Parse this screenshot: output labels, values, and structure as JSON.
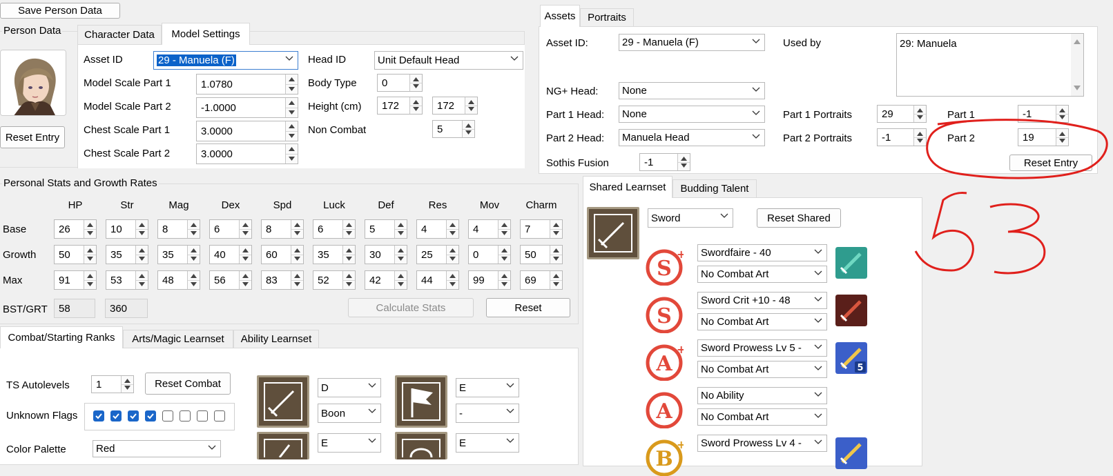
{
  "toolbar": {
    "save_person": "Save Person Data"
  },
  "person_data": {
    "group_label": "Person Data",
    "reset_entry": "Reset Entry",
    "tabs": [
      "Character Data",
      "Model Settings"
    ],
    "model": {
      "asset_id_label": "Asset ID",
      "asset_id_value": "29 - Manuela (F)",
      "head_id_label": "Head ID",
      "head_id_value": "Unit Default Head",
      "scale1_label": "Model Scale Part 1",
      "scale1_value": "1.0780",
      "scale2_label": "Model Scale Part 2",
      "scale2_value": "-1.0000",
      "chest1_label": "Chest Scale Part 1",
      "chest1_value": "3.0000",
      "chest2_label": "Chest Scale Part 2",
      "chest2_value": "3.0000",
      "body_type_label": "Body Type",
      "body_type_value": "0",
      "height_label": "Height (cm)",
      "height_value1": "172",
      "height_value2": "172",
      "non_combat_label": "Non Combat",
      "non_combat_value": "5"
    }
  },
  "assets": {
    "tabs": [
      "Assets",
      "Portraits"
    ],
    "asset_id_label": "Asset ID:",
    "asset_id_value": "29 - Manuela (F)",
    "used_by_label": "Used by",
    "used_by_value": "29: Manuela",
    "ng_head_label": "NG+ Head:",
    "ng_head_value": "None",
    "part1_head_label": "Part 1 Head:",
    "part1_head_value": "None",
    "part2_head_label": "Part 2 Head:",
    "part2_head_value": "Manuela Head",
    "part1_portraits_label": "Part 1 Portraits",
    "part1_portraits_value": "29",
    "part2_portraits_label": "Part 2 Portraits",
    "part2_portraits_value": "-1",
    "part1_label": "Part 1",
    "part1_value": "-1",
    "part2_label": "Part 2",
    "part2_value": "19",
    "sothis_label": "Sothis Fusion",
    "sothis_value": "-1",
    "reset_entry": "Reset Entry"
  },
  "stats": {
    "group_label": "Personal Stats and Growth Rates",
    "columns": [
      "HP",
      "Str",
      "Mag",
      "Dex",
      "Spd",
      "Luck",
      "Def",
      "Res",
      "Mov",
      "Charm"
    ],
    "row_labels": [
      "Base",
      "Growth",
      "Max"
    ],
    "base": [
      "26",
      "10",
      "8",
      "6",
      "8",
      "6",
      "5",
      "4",
      "4",
      "7"
    ],
    "growth": [
      "50",
      "35",
      "35",
      "40",
      "60",
      "35",
      "30",
      "25",
      "0",
      "50"
    ],
    "max": [
      "91",
      "53",
      "48",
      "56",
      "83",
      "52",
      "42",
      "44",
      "99",
      "69"
    ],
    "bst_label": "BST/GRT",
    "bst_value": "58",
    "grt_value": "360",
    "calculate": "Calculate Stats",
    "reset": "Reset"
  },
  "combat": {
    "tabs": [
      "Combat/Starting Ranks",
      "Arts/Magic Learnset",
      "Ability Learnset"
    ],
    "ts_autolevels_label": "TS Autolevels",
    "ts_autolevels_value": "1",
    "reset_combat": "Reset Combat",
    "unknown_flags_label": "Unknown Flags",
    "flags": [
      true,
      true,
      true,
      true,
      false,
      false,
      false,
      false
    ],
    "color_palette_label": "Color Palette",
    "color_palette_value": "Red",
    "rank1": "D",
    "rank1_mod": "Boon",
    "rank2": "E",
    "rank2_mod": "-",
    "rank3": "E",
    "rank4": "E"
  },
  "learnset": {
    "tabs": [
      "Shared Learnset",
      "Budding Talent"
    ],
    "weapon_value": "Sword",
    "reset_shared": "Reset Shared",
    "rows": [
      {
        "grade": "S+",
        "ability": "Swordfaire - 40",
        "art": "No Combat Art",
        "icon": "swordfaire-icon"
      },
      {
        "grade": "S",
        "ability": "Sword Crit +10 - 48",
        "art": "No Combat Art",
        "icon": "sword-crit-icon"
      },
      {
        "grade": "A+",
        "ability": "Sword Prowess Lv 5 -",
        "art": "No Combat Art",
        "icon": "sword-prowess-5-icon"
      },
      {
        "grade": "A",
        "ability": "No Ability",
        "art": "No Combat Art",
        "icon": ""
      },
      {
        "grade": "B+",
        "ability": "Sword Prowess Lv 4 -",
        "art": "",
        "icon": "sword-prowess-4-icon"
      }
    ]
  },
  "annotation": {
    "text": "53",
    "color": "#e0201c"
  }
}
